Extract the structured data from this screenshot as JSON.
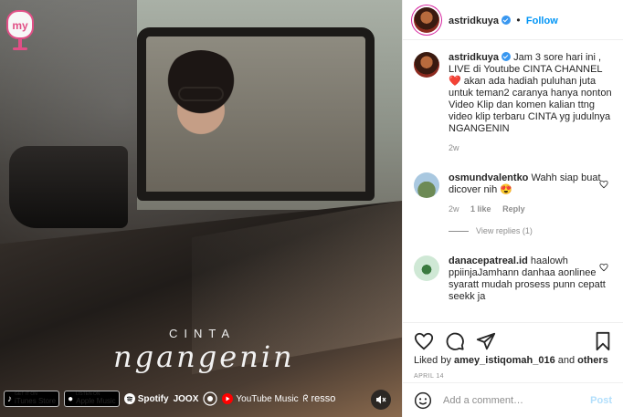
{
  "post": {
    "username": "astridkuya",
    "follow_label": "Follow",
    "dot": "•"
  },
  "media": {
    "title_small": "CINTA",
    "title_script": "ngangenin",
    "store_badges": [
      {
        "small": "GET IT ON",
        "label": "iTunes Store"
      },
      {
        "small": "LISTEN ON",
        "label": "Apple Music"
      }
    ],
    "services": [
      "Spotify",
      "JOOX",
      "YouTube Music",
      "resso"
    ]
  },
  "caption": {
    "username": "astridkuya",
    "text": "Jam 3 sore hari ini , LIVE di Youtube CINTA CHANNEL ❤️ akan ada hadiah puluhan juta untuk teman2 caranya hanya nonton Video Klip dan komen kalian ttng video klip terbaru CINTA yg judulnya NGANGENIN",
    "age": "2w"
  },
  "comments": [
    {
      "username": "osmundvalentko",
      "text": "Wahh siap buat dicover nih 😍",
      "age": "2w",
      "likes": "1 like",
      "reply_label": "Reply",
      "view_replies": "View replies (1)"
    },
    {
      "username": "danacepatreal.id",
      "text": "haalowh ppiinjaJamhann danhaa aonlinee syaratt mudah prosess punn cepatt seekk ja"
    }
  ],
  "actions": {
    "likes_prefix": "Liked by ",
    "likes_user": "amey_istiqomah_016",
    "likes_suffix": " and ",
    "likes_others": "others",
    "date": "APRIL 14"
  },
  "add_comment": {
    "placeholder": "Add a comment…",
    "post_label": "Post"
  },
  "colors": {
    "accent": "#0095f6",
    "verified": "#3897f0",
    "heart": "#ed4956"
  },
  "icons": [
    "my-logo-icon",
    "mute-icon",
    "heart-icon",
    "comment-icon",
    "share-icon",
    "bookmark-icon",
    "emoji-icon",
    "verified-icon"
  ]
}
